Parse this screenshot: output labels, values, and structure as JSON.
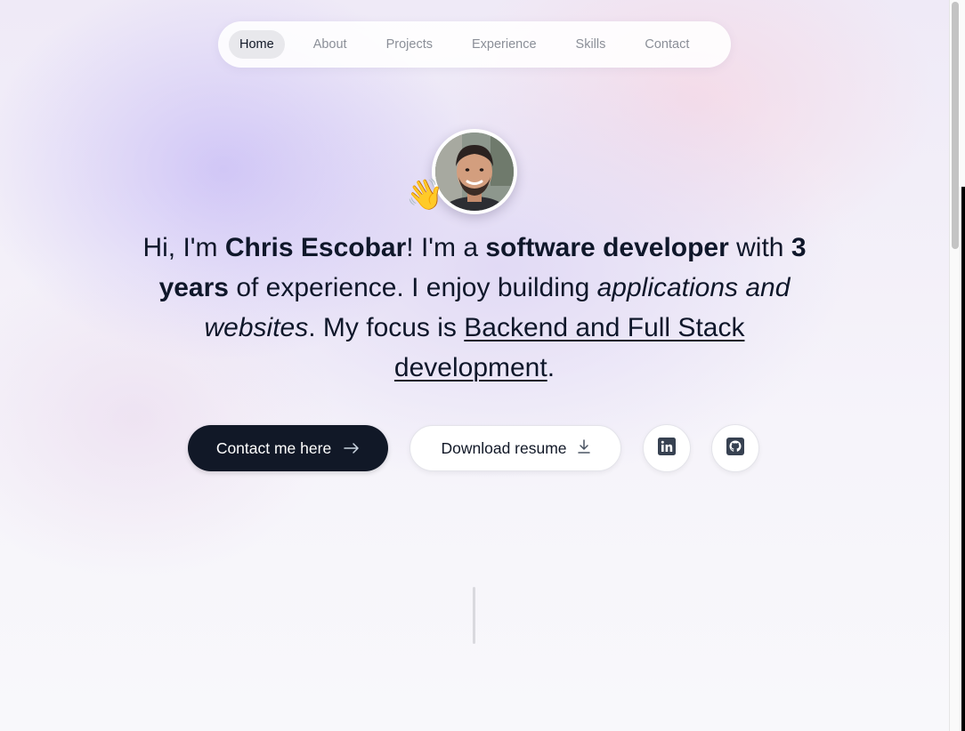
{
  "nav": {
    "items": [
      {
        "label": "Home",
        "active": true
      },
      {
        "label": "About",
        "active": false
      },
      {
        "label": "Projects",
        "active": false
      },
      {
        "label": "Experience",
        "active": false
      },
      {
        "label": "Skills",
        "active": false
      },
      {
        "label": "Contact",
        "active": false
      }
    ]
  },
  "hero": {
    "wave_emoji": "👋",
    "intro": {
      "p1": "Hi, I'm ",
      "name": "Chris Escobar",
      "p2": "! I'm a ",
      "role": "software developer",
      "p3": " with ",
      "years": "3 years",
      "p4": " of experience. I enjoy building ",
      "building": "applications and websites",
      "p5": ". My focus is ",
      "focus": "Backend and Full Stack development",
      "p6": "."
    },
    "buttons": {
      "contact_label": "Contact me here",
      "contact_icon": "arrow-right-icon",
      "resume_label": "Download resume",
      "resume_icon": "download-icon",
      "linkedin_icon": "linkedin-icon",
      "github_icon": "github-icon"
    }
  },
  "colors": {
    "primary_dark": "#111827",
    "nav_active_bg": "#e8e8ec",
    "text_muted": "#8b8f98"
  }
}
